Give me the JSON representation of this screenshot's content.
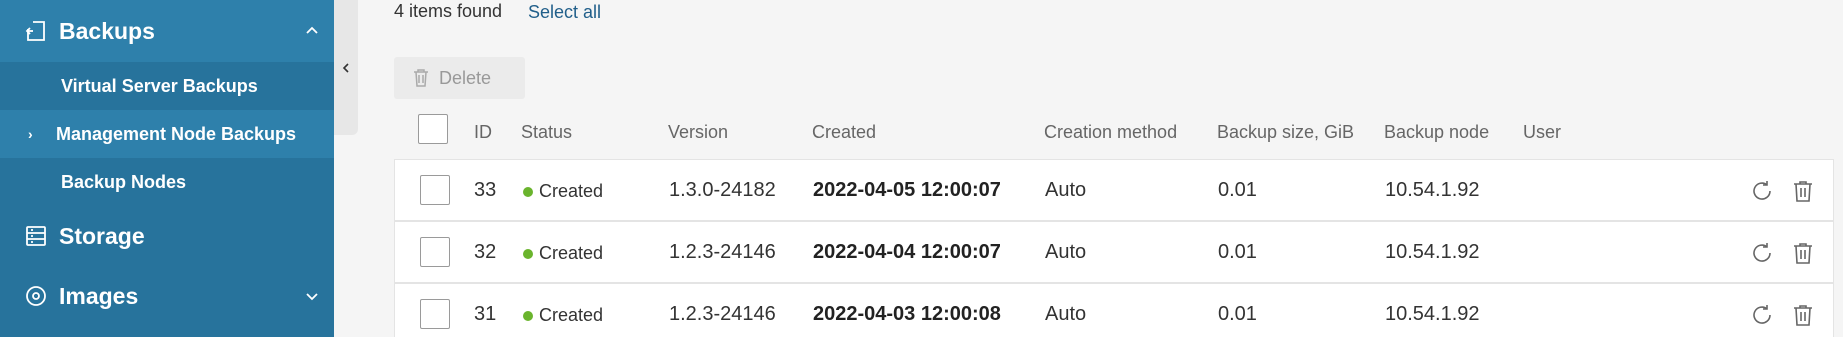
{
  "sidebar": {
    "backups_label": "Backups",
    "sub_items": [
      "Virtual Server Backups",
      "Management Node Backups",
      "Backup Nodes"
    ],
    "active_caret": "›",
    "storage_label": "Storage",
    "images_label": "Images"
  },
  "header": {
    "found_text": "4 items found",
    "select_all": "Select all",
    "delete_label": "Delete"
  },
  "table": {
    "columns": [
      "ID",
      "Status",
      "Version",
      "Created",
      "Creation method",
      "Backup size, GiB",
      "Backup node",
      "User"
    ],
    "rows": [
      {
        "id": "33",
        "status": "Created",
        "version": "1.3.0-24182",
        "created": "2022-04-05 12:00:07",
        "method": "Auto",
        "size": "0.01",
        "node": "10.54.1.92",
        "user": ""
      },
      {
        "id": "32",
        "status": "Created",
        "version": "1.2.3-24146",
        "created": "2022-04-04 12:00:07",
        "method": "Auto",
        "size": "0.01",
        "node": "10.54.1.92",
        "user": ""
      },
      {
        "id": "31",
        "status": "Created",
        "version": "1.2.3-24146",
        "created": "2022-04-03 12:00:08",
        "method": "Auto",
        "size": "0.01",
        "node": "10.54.1.92",
        "user": ""
      }
    ]
  },
  "colors": {
    "sidebar_bg": "#27739c",
    "sidebar_active": "#2e80ab",
    "link": "#215f8a",
    "status_ok": "#6ab42d"
  },
  "icons": [
    "backup-icon",
    "storage-icon",
    "images-icon",
    "chevron-up-icon",
    "chevron-down-icon",
    "collapse-left-icon",
    "trash-icon",
    "restore-icon"
  ]
}
